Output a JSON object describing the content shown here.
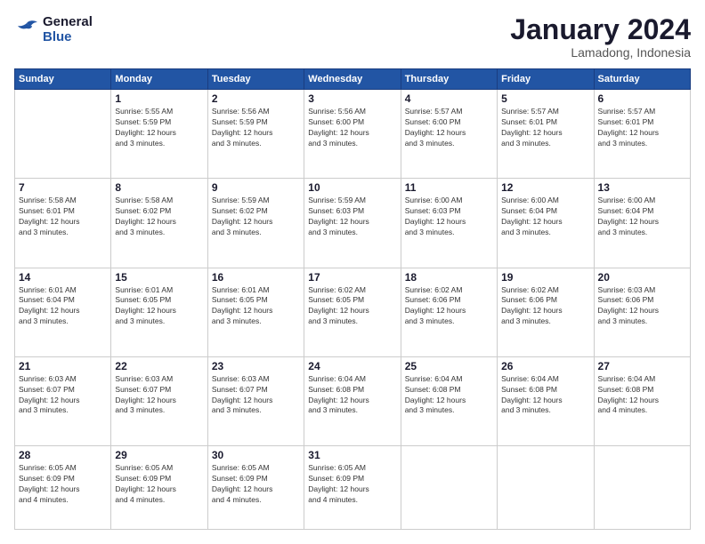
{
  "logo": {
    "line1": "General",
    "line2": "Blue"
  },
  "title": "January 2024",
  "location": "Lamadong, Indonesia",
  "days_header": [
    "Sunday",
    "Monday",
    "Tuesday",
    "Wednesday",
    "Thursday",
    "Friday",
    "Saturday"
  ],
  "weeks": [
    [
      {
        "day": "",
        "info": ""
      },
      {
        "day": "1",
        "info": "Sunrise: 5:55 AM\nSunset: 5:59 PM\nDaylight: 12 hours\nand 3 minutes."
      },
      {
        "day": "2",
        "info": "Sunrise: 5:56 AM\nSunset: 5:59 PM\nDaylight: 12 hours\nand 3 minutes."
      },
      {
        "day": "3",
        "info": "Sunrise: 5:56 AM\nSunset: 6:00 PM\nDaylight: 12 hours\nand 3 minutes."
      },
      {
        "day": "4",
        "info": "Sunrise: 5:57 AM\nSunset: 6:00 PM\nDaylight: 12 hours\nand 3 minutes."
      },
      {
        "day": "5",
        "info": "Sunrise: 5:57 AM\nSunset: 6:01 PM\nDaylight: 12 hours\nand 3 minutes."
      },
      {
        "day": "6",
        "info": "Sunrise: 5:57 AM\nSunset: 6:01 PM\nDaylight: 12 hours\nand 3 minutes."
      }
    ],
    [
      {
        "day": "7",
        "info": "Sunrise: 5:58 AM\nSunset: 6:01 PM\nDaylight: 12 hours\nand 3 minutes."
      },
      {
        "day": "8",
        "info": "Sunrise: 5:58 AM\nSunset: 6:02 PM\nDaylight: 12 hours\nand 3 minutes."
      },
      {
        "day": "9",
        "info": "Sunrise: 5:59 AM\nSunset: 6:02 PM\nDaylight: 12 hours\nand 3 minutes."
      },
      {
        "day": "10",
        "info": "Sunrise: 5:59 AM\nSunset: 6:03 PM\nDaylight: 12 hours\nand 3 minutes."
      },
      {
        "day": "11",
        "info": "Sunrise: 6:00 AM\nSunset: 6:03 PM\nDaylight: 12 hours\nand 3 minutes."
      },
      {
        "day": "12",
        "info": "Sunrise: 6:00 AM\nSunset: 6:04 PM\nDaylight: 12 hours\nand 3 minutes."
      },
      {
        "day": "13",
        "info": "Sunrise: 6:00 AM\nSunset: 6:04 PM\nDaylight: 12 hours\nand 3 minutes."
      }
    ],
    [
      {
        "day": "14",
        "info": "Sunrise: 6:01 AM\nSunset: 6:04 PM\nDaylight: 12 hours\nand 3 minutes."
      },
      {
        "day": "15",
        "info": "Sunrise: 6:01 AM\nSunset: 6:05 PM\nDaylight: 12 hours\nand 3 minutes."
      },
      {
        "day": "16",
        "info": "Sunrise: 6:01 AM\nSunset: 6:05 PM\nDaylight: 12 hours\nand 3 minutes."
      },
      {
        "day": "17",
        "info": "Sunrise: 6:02 AM\nSunset: 6:05 PM\nDaylight: 12 hours\nand 3 minutes."
      },
      {
        "day": "18",
        "info": "Sunrise: 6:02 AM\nSunset: 6:06 PM\nDaylight: 12 hours\nand 3 minutes."
      },
      {
        "day": "19",
        "info": "Sunrise: 6:02 AM\nSunset: 6:06 PM\nDaylight: 12 hours\nand 3 minutes."
      },
      {
        "day": "20",
        "info": "Sunrise: 6:03 AM\nSunset: 6:06 PM\nDaylight: 12 hours\nand 3 minutes."
      }
    ],
    [
      {
        "day": "21",
        "info": "Sunrise: 6:03 AM\nSunset: 6:07 PM\nDaylight: 12 hours\nand 3 minutes."
      },
      {
        "day": "22",
        "info": "Sunrise: 6:03 AM\nSunset: 6:07 PM\nDaylight: 12 hours\nand 3 minutes."
      },
      {
        "day": "23",
        "info": "Sunrise: 6:03 AM\nSunset: 6:07 PM\nDaylight: 12 hours\nand 3 minutes."
      },
      {
        "day": "24",
        "info": "Sunrise: 6:04 AM\nSunset: 6:08 PM\nDaylight: 12 hours\nand 3 minutes."
      },
      {
        "day": "25",
        "info": "Sunrise: 6:04 AM\nSunset: 6:08 PM\nDaylight: 12 hours\nand 3 minutes."
      },
      {
        "day": "26",
        "info": "Sunrise: 6:04 AM\nSunset: 6:08 PM\nDaylight: 12 hours\nand 3 minutes."
      },
      {
        "day": "27",
        "info": "Sunrise: 6:04 AM\nSunset: 6:08 PM\nDaylight: 12 hours\nand 4 minutes."
      }
    ],
    [
      {
        "day": "28",
        "info": "Sunrise: 6:05 AM\nSunset: 6:09 PM\nDaylight: 12 hours\nand 4 minutes."
      },
      {
        "day": "29",
        "info": "Sunrise: 6:05 AM\nSunset: 6:09 PM\nDaylight: 12 hours\nand 4 minutes."
      },
      {
        "day": "30",
        "info": "Sunrise: 6:05 AM\nSunset: 6:09 PM\nDaylight: 12 hours\nand 4 minutes."
      },
      {
        "day": "31",
        "info": "Sunrise: 6:05 AM\nSunset: 6:09 PM\nDaylight: 12 hours\nand 4 minutes."
      },
      {
        "day": "",
        "info": ""
      },
      {
        "day": "",
        "info": ""
      },
      {
        "day": "",
        "info": ""
      }
    ]
  ]
}
